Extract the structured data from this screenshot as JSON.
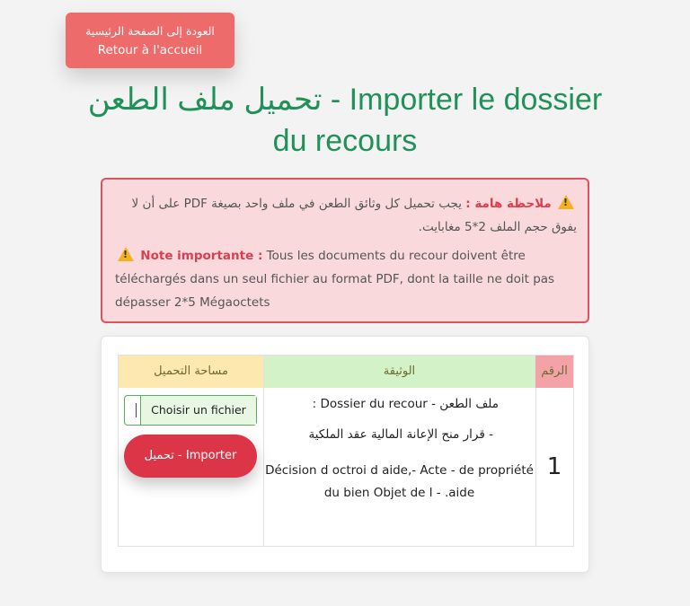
{
  "nav": {
    "back_label_ar": "العودة إلى الصفحة الرئيسية",
    "back_label_fr": "Retour à l'accueil"
  },
  "page": {
    "title": "تحميل ملف الطعن - Importer le dossier du recours"
  },
  "note": {
    "warning_icon": "warning-icon",
    "ar_heading": "ملاحظة هامة :",
    "ar_text": "يجب تحميل كل وثائق الطعن في ملف واحد بصيغة PDF على أن لا يفوق حجم الملف 2*5 مغابايت.",
    "fr_heading": "Note importante :",
    "fr_text": "Tous les documents du recour doivent être téléchargés dans un seul fichier au format PDF, dont la taille ne doit pas dépasser 2*5 Mégaoctets"
  },
  "table": {
    "headers": {
      "upload": "مساحة التحميل",
      "document": "الوثيقة",
      "number": "الرقم"
    },
    "rows": [
      {
        "number": "1",
        "doc_line1": "ملف الطعن - Dossier du recour :",
        "doc_line2": "- قرار منح الإعانة المالية عقد الملكية",
        "doc_fr": "Décision d octroi d aide,- Acte - de propriété du bien Objet de l - .aide",
        "file_button": "Choisir un fichier",
        "import_button": "تحميل - Importer"
      }
    ]
  },
  "colors": {
    "title_green": "#20915a",
    "back_button": "#ee6b6b",
    "import_button": "#dc3548",
    "note_bg": "#f9d9dc",
    "note_border": "#d9545d"
  }
}
